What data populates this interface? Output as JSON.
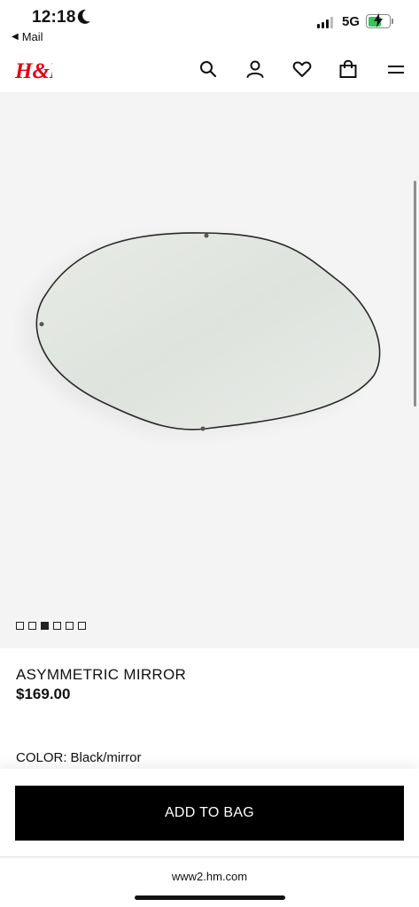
{
  "status_bar": {
    "time": "12:18",
    "back_label": "Mail",
    "network": "5G",
    "icons": [
      "moon-icon",
      "signal-icon",
      "battery-charging-icon"
    ]
  },
  "header": {
    "logo_text": "H&M",
    "brand_color": "#e50010",
    "icons": [
      "search-icon",
      "account-icon",
      "favorites-heart-icon",
      "shopping-bag-icon",
      "menu-icon"
    ]
  },
  "gallery": {
    "image_count": 6,
    "active_index": 2,
    "image_subject": "mirror-image"
  },
  "product": {
    "name": "ASYMMETRIC MIRROR",
    "price": "$169.00",
    "color_label": "COLOR:",
    "color_value": "Black/mirror"
  },
  "actions": {
    "add_to_bag": "ADD TO BAG"
  },
  "browser": {
    "url": "www2.hm.com"
  }
}
